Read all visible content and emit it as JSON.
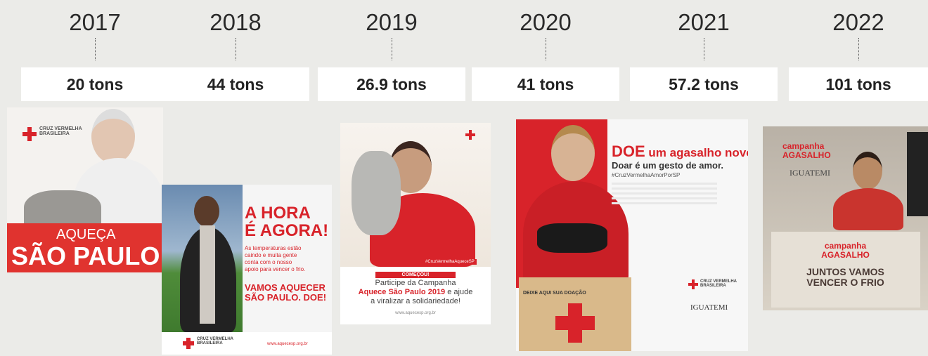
{
  "timeline": [
    {
      "year": "2017",
      "tons": "20 tons"
    },
    {
      "year": "2018",
      "tons": "44 tons"
    },
    {
      "year": "2019",
      "tons": "26.9 tons"
    },
    {
      "year": "2020",
      "tons": "41 tons"
    },
    {
      "year": "2021",
      "tons": "57.2 tons"
    },
    {
      "year": "2022",
      "tons": "101 tons"
    }
  ],
  "posters": {
    "p2017": {
      "org": "CRUZ VERMELHA\nBRASILEIRA",
      "line1": "AQUEÇA",
      "line2": "SÃO PAULO"
    },
    "p2018": {
      "headline": "A HORA\nÉ AGORA!",
      "body": "As temperaturas estão\ncaindo e muita gente\nconta com o nosso\napoio para vencer o frio.",
      "cta": "VAMOS AQUECER\nSÃO PAULO. DOE!",
      "org": "CRUZ VERMELHA\nBRASILEIRA",
      "url": "www.aquecesp.org.br"
    },
    "p2019": {
      "badge": "COMEÇOU!",
      "text1": "Participe da Campanha",
      "text2": "Aquece São Paulo 2019",
      "text3": "e ajude",
      "text4": "a viralizar a solidariedade!",
      "hashtag": "#CruzVermelhaAqueceSP",
      "url": "www.aquecesp.org.br"
    },
    "p2020": {
      "doe": "DOE",
      "headline_rest": " um agasalho novo!",
      "sub": "Doar é um gesto de amor.",
      "hashtag": "#CruzVermelhaAmorPorSP",
      "box": "DEIXE AQUI SUA DOAÇÃO",
      "org": "CRUZ VERMELHA\nBRASILEIRA",
      "partner": "IGUATEMI"
    },
    "p2022": {
      "campaign": "campanha\nAGASALHO",
      "partner": "IGUATEMI",
      "tagline": "JUNTOS VAMOS\nVENCER O FRIO"
    }
  },
  "colors": {
    "red": "#d8232a",
    "background": "#ebebe8"
  }
}
